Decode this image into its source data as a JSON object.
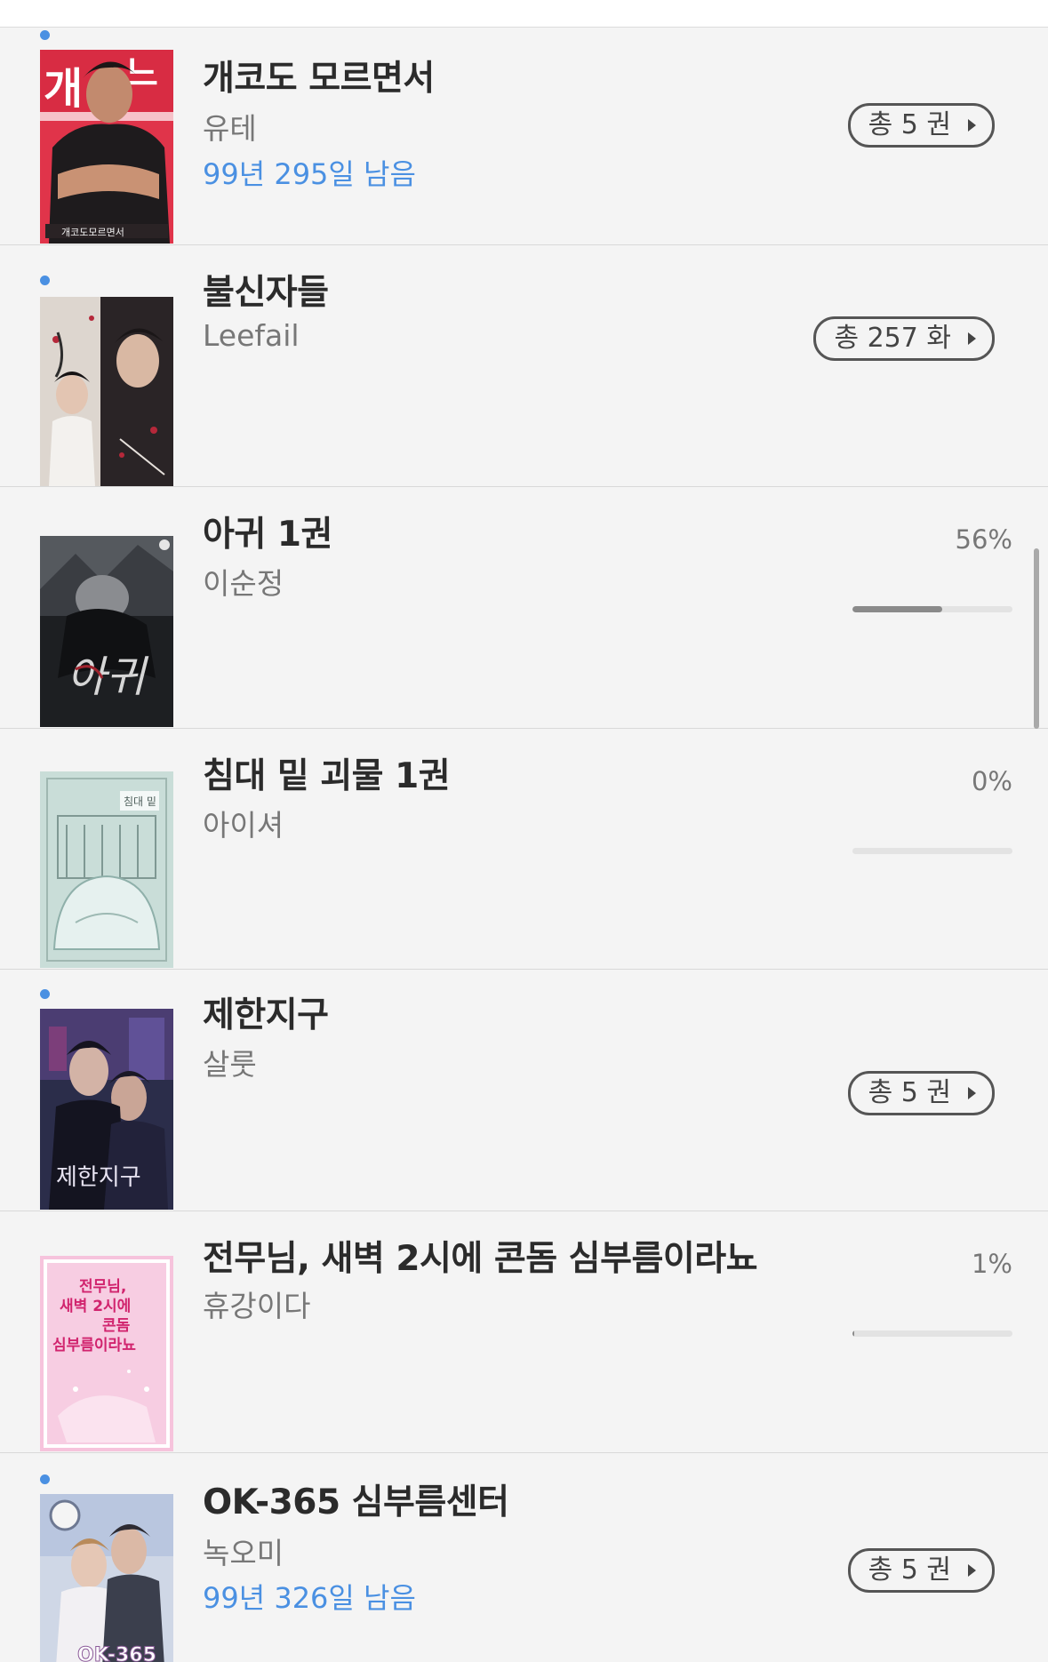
{
  "colors": {
    "accent": "#4a90e2",
    "background": "#f4f4f4",
    "divider": "#d9d9d9"
  },
  "books": [
    {
      "title": "개코도 모르면서",
      "author": "유테",
      "remaining": "99년 295일 남음",
      "total_label": "총 5 권",
      "new": true
    },
    {
      "title": "불신자들",
      "author": "Leefail",
      "total_label": "총 257 화",
      "new": true
    },
    {
      "title": "아귀 1권",
      "author": "이순정",
      "progress_label": "56%",
      "progress": 0.56,
      "new": false
    },
    {
      "title": "침대 밑 괴물 1권",
      "author": "아이셔",
      "progress_label": "0%",
      "progress": 0.0,
      "new": false
    },
    {
      "title": "제한지구",
      "author": "살룻",
      "total_label": "총 5 권",
      "new": true
    },
    {
      "title": "전무님, 새벽 2시에 콘돔 심부름이라뇨",
      "author": "휴강이다",
      "progress_label": "1%",
      "progress": 0.01,
      "new": false
    },
    {
      "title": "OK-365 심부름센터",
      "author": "녹오미",
      "remaining": "99년 326일 남음",
      "total_label": "총 5 권",
      "new": true
    }
  ],
  "scroll_position": 0.45
}
